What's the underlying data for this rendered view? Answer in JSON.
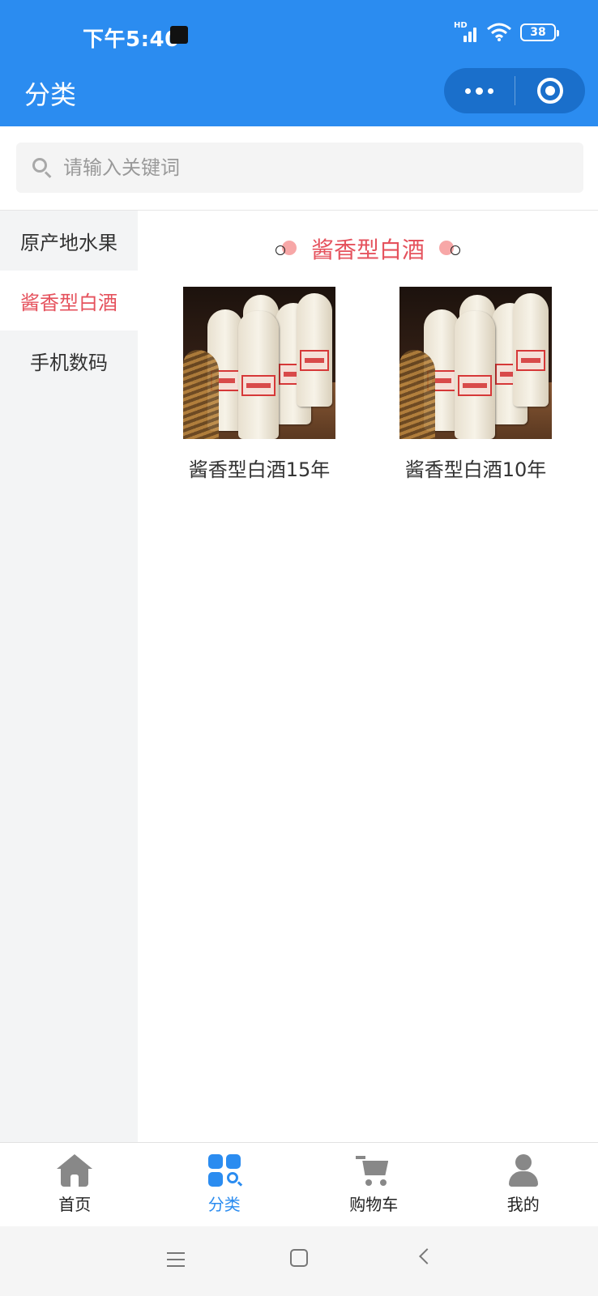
{
  "status_bar": {
    "time": "下午5:40",
    "network": "HD",
    "battery": "38"
  },
  "nav": {
    "title": "分类"
  },
  "search": {
    "placeholder": "请输入关键词"
  },
  "sidebar": {
    "items": [
      {
        "label": "原产地水果",
        "active": false
      },
      {
        "label": "酱香型白酒",
        "active": true
      },
      {
        "label": "手机数码",
        "active": false
      }
    ]
  },
  "content": {
    "category_title": "酱香型白酒",
    "products": [
      {
        "name": "酱香型白酒15年"
      },
      {
        "name": "酱香型白酒10年"
      }
    ]
  },
  "tabbar": {
    "items": [
      {
        "label": "首页",
        "icon": "home-icon",
        "active": false
      },
      {
        "label": "分类",
        "icon": "category-icon",
        "active": true
      },
      {
        "label": "购物车",
        "icon": "cart-icon",
        "active": false
      },
      {
        "label": "我的",
        "icon": "user-icon",
        "active": false
      }
    ]
  },
  "colors": {
    "primary": "#2b8cf0",
    "accent_red": "#e5525d",
    "sidebar_bg": "#f3f4f5"
  }
}
